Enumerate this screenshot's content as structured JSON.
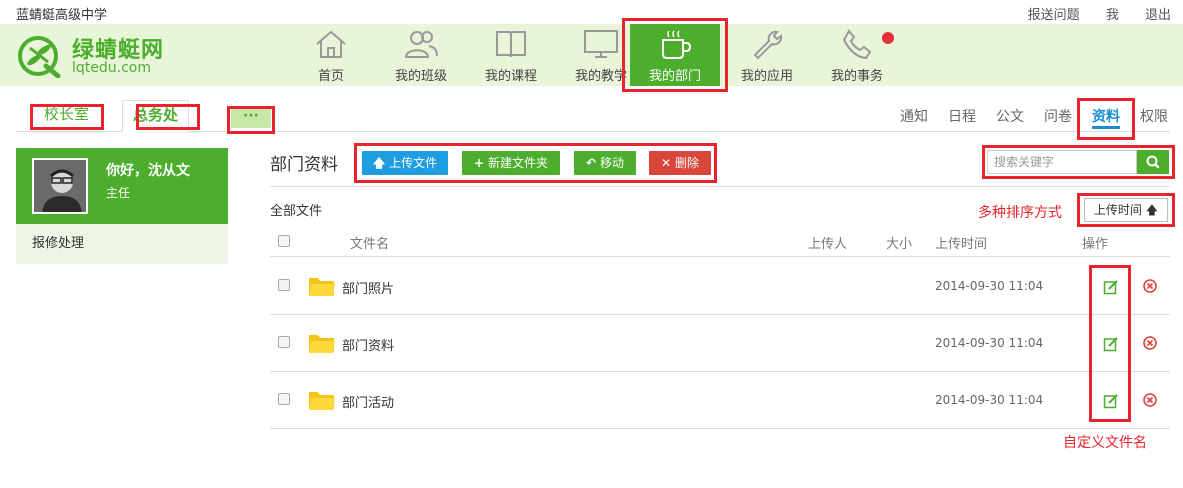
{
  "topbar": {
    "school": "蓝蜻蜓高级中学",
    "links": [
      "报送问题",
      "我",
      "退出"
    ]
  },
  "logo": {
    "cn": "绿蜻蜓网",
    "en": "lqtedu.com"
  },
  "nav": [
    {
      "label": "首页",
      "icon": "home-icon"
    },
    {
      "label": "我的班级",
      "icon": "people-icon"
    },
    {
      "label": "我的课程",
      "icon": "book-icon"
    },
    {
      "label": "我的教学",
      "icon": "monitor-icon"
    },
    {
      "label": "我的部门",
      "icon": "coffee-cup-icon",
      "active": true
    },
    {
      "label": "我的应用",
      "icon": "wrench-icon"
    },
    {
      "label": "我的事务",
      "icon": "phone-icon",
      "badge": true
    }
  ],
  "dept_tabs": {
    "tab1": "校长室",
    "tab2": "总务处",
    "more": "···"
  },
  "right_tabs": [
    "通知",
    "日程",
    "公文",
    "问卷",
    "资料",
    "权限"
  ],
  "profile": {
    "greeting": "你好，沈从文",
    "role": "主任"
  },
  "sidebar": {
    "item": "报修处理"
  },
  "main": {
    "title": "部门资料",
    "buttons": {
      "upload": "上传文件",
      "new_folder": "新建文件夹",
      "move": "移动",
      "delete": "删除"
    },
    "search_placeholder": "搜索关键字",
    "all_files": "全部文件",
    "sort_note": "多种排序方式",
    "sort_button": "上传时间",
    "columns": {
      "name": "文件名",
      "uploader": "上传人",
      "size": "大小",
      "time": "上传时间",
      "ops": "操作"
    },
    "rows": [
      {
        "name": "部门照片",
        "time": "2014-09-30 11:04"
      },
      {
        "name": "部门资料",
        "time": "2014-09-30 11:04"
      },
      {
        "name": "部门活动",
        "time": "2014-09-30 11:04"
      }
    ],
    "custom_note": "自定义文件名"
  },
  "colors": {
    "accent_green": "#4cae2c",
    "header_bg": "#e8f5d8",
    "annotation_red": "#e8242c",
    "tab_blue": "#1a8fd6"
  }
}
